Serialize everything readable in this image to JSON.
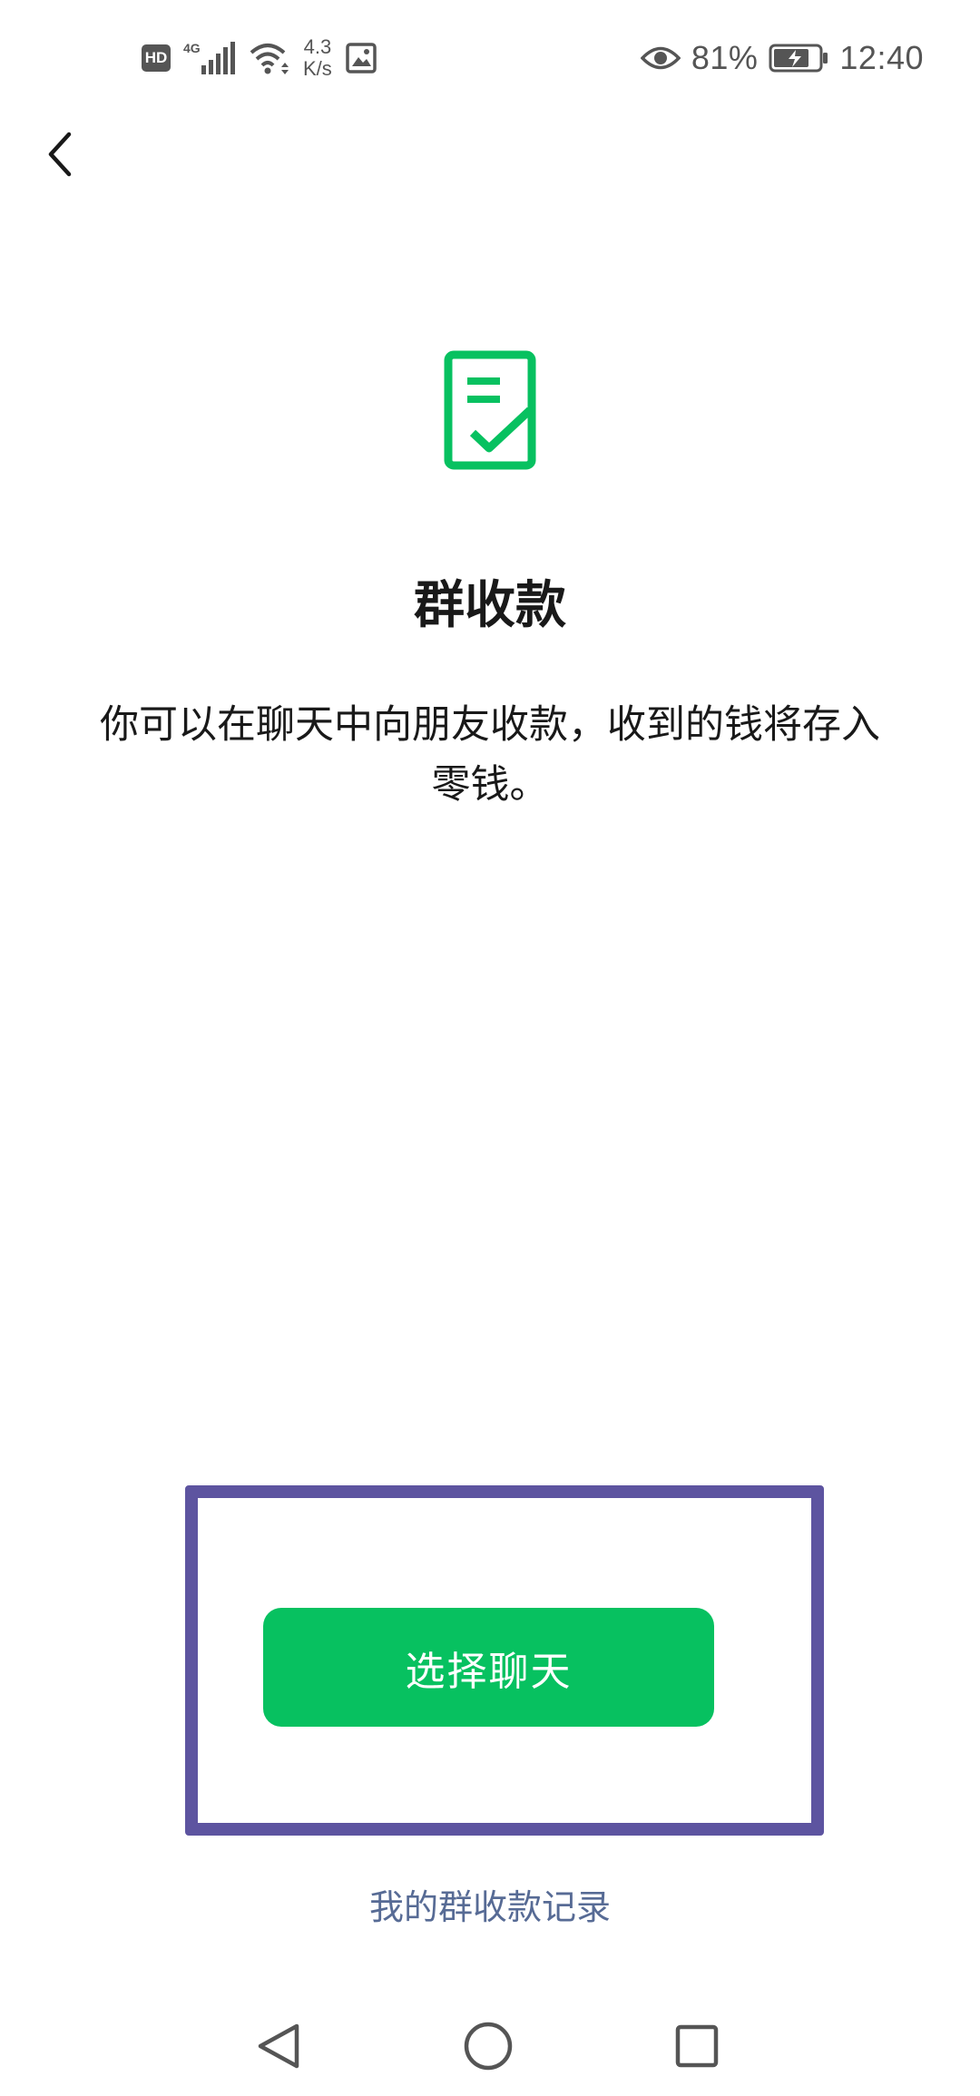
{
  "status_bar": {
    "hd_badge": "HD",
    "network": "4G",
    "speed_value": "4.3",
    "speed_unit": "K/s",
    "battery_percent": "81%",
    "time": "12:40",
    "icons": [
      "hd-icon",
      "signal-icon",
      "wifi-icon",
      "image-alert-icon",
      "eye-icon",
      "battery-charging-icon"
    ]
  },
  "header": {
    "back_icon": "chevron-left-icon"
  },
  "hero": {
    "icon": "document-check-icon",
    "icon_color": "#07c160",
    "title": "群收款",
    "description": "你可以在聊天中向朋友收款，收到的钱将存入零钱。"
  },
  "actions": {
    "primary_button": "选择聊天",
    "primary_color": "#07c160",
    "frame_color": "#5d54a0",
    "records_link": "我的群收款记录",
    "link_color": "#576b95"
  },
  "nav_bar": {
    "back": "triangle-back-icon",
    "home": "circle-home-icon",
    "recents": "square-recents-icon"
  }
}
